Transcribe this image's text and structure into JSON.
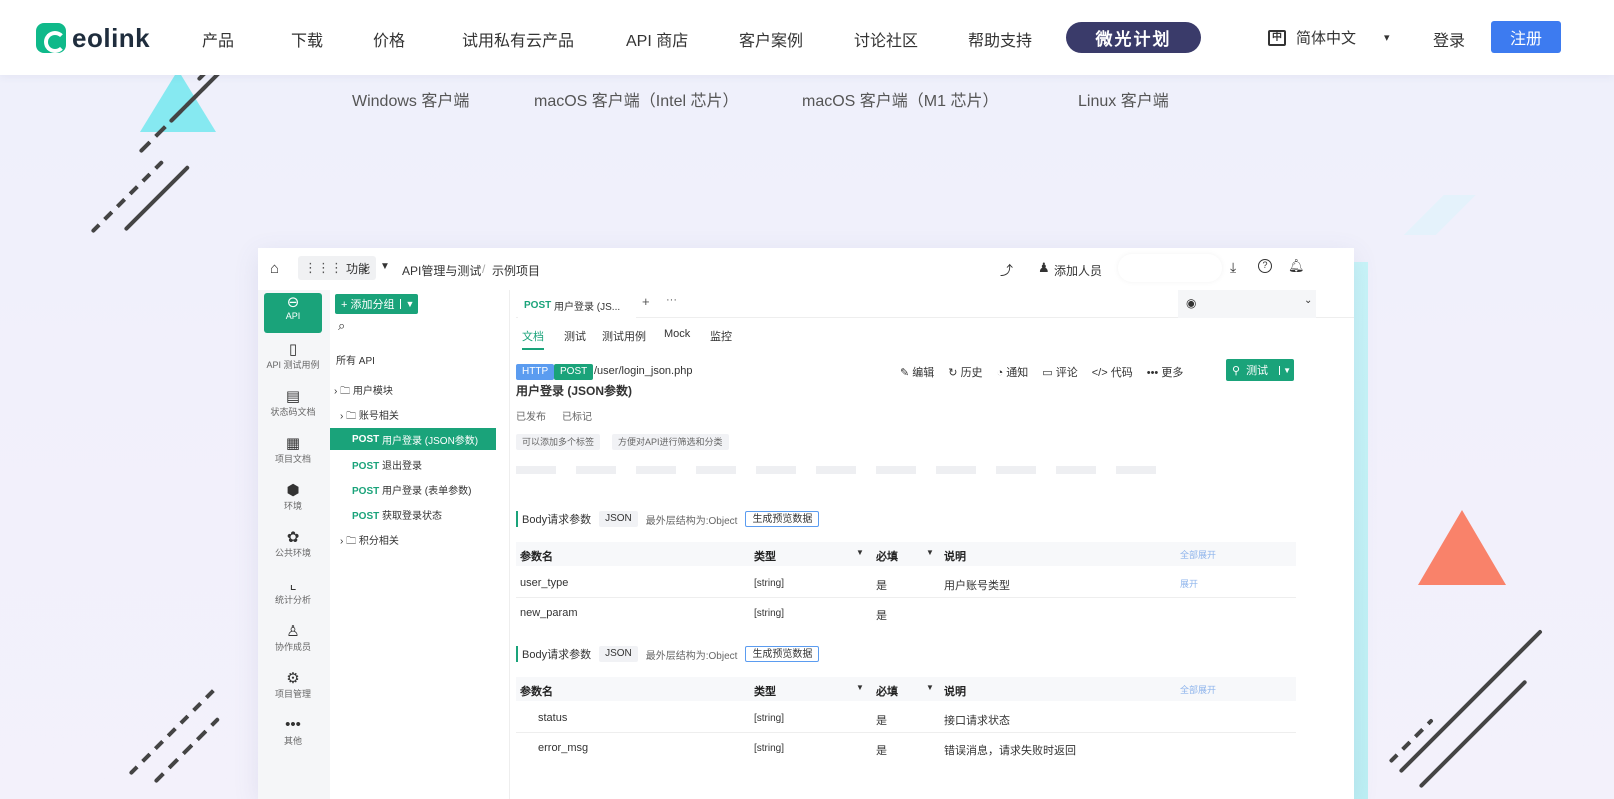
{
  "nav": {
    "brand": "eolink",
    "items": [
      "产品",
      "下载",
      "价格",
      "试用私有云产品",
      "API 商店",
      "客户案例",
      "讨论社区",
      "帮助支持"
    ],
    "badge": "微光计划",
    "lang_icon": "中",
    "lang": "简体中文",
    "login": "登录",
    "signup": "注册"
  },
  "downloads": [
    "Windows 客户端",
    "macOS 客户端（Intel 芯片）",
    "macOS 客户端（M1 芯片）",
    "Linux 客户端"
  ],
  "app": {
    "topbar": {
      "features": "功能",
      "breadcrumb_root": "API管理与测试",
      "breadcrumb_sep": "/",
      "breadcrumb_project": "示例项目",
      "add_member": "添加人员"
    },
    "leftbar": [
      {
        "icon": "link-icon",
        "label": "API"
      },
      {
        "icon": "clipboard-icon",
        "label": "API 测试用例"
      },
      {
        "icon": "doc-status-icon",
        "label": "状态码文档"
      },
      {
        "icon": "project-doc-icon",
        "label": "项目文档"
      },
      {
        "icon": "environment-icon",
        "label": "环境"
      },
      {
        "icon": "public-env-icon",
        "label": "公共环境"
      },
      {
        "icon": "chart-icon",
        "label": "统计分析"
      },
      {
        "icon": "member-icon",
        "label": "协作成员"
      },
      {
        "icon": "settings-icon",
        "label": "项目管理"
      },
      {
        "icon": "more-icon",
        "label": "其他"
      }
    ],
    "tree": {
      "add_group": "+ 添加分组",
      "all_api": "所有 API",
      "user_module": "用户模块",
      "account": "账号相关",
      "apis": [
        {
          "method": "POST",
          "name": "用户登录 (JSON参数)"
        },
        {
          "method": "POST",
          "name": "退出登录"
        },
        {
          "method": "POST",
          "name": "用户登录 (表单参数)"
        },
        {
          "method": "POST",
          "name": "获取登录状态"
        }
      ],
      "points": "积分相关"
    },
    "tab": {
      "method": "POST",
      "title": "用户登录 (JS..."
    },
    "subtabs": [
      "文档",
      "测试",
      "测试用例",
      "Mock",
      "监控"
    ],
    "api": {
      "protocol": "HTTP",
      "method": "POST",
      "path": "/user/login_json.php",
      "title": "用户登录 (JSON参数)",
      "status1": "已发布",
      "status2": "已标记",
      "tag1": "可以添加多个标签",
      "tag2": "方便对API进行筛选和分类"
    },
    "actions": [
      "编辑",
      "历史",
      "通知",
      "评论",
      "代码",
      "更多"
    ],
    "test_btn": "测试",
    "section1": {
      "title": "Body请求参数",
      "type": "JSON",
      "struct": "最外层结构为:Object",
      "gen": "生成预览数据"
    },
    "section2": {
      "title": "Body请求参数",
      "type": "JSON",
      "struct": "最外层结构为:Object",
      "gen": "生成预览数据"
    },
    "headers": {
      "name": "参数名",
      "type": "类型",
      "required": "必填",
      "desc": "说明",
      "expand": "全部展开"
    },
    "rows1": [
      {
        "name": "user_type",
        "type": "[string]",
        "required": "是",
        "desc": "用户账号类型",
        "extra": "展开"
      },
      {
        "name": "new_param",
        "type": "[string]",
        "required": "是",
        "desc": "",
        "extra": ""
      }
    ],
    "rows2": [
      {
        "name": "status",
        "type": "[string]",
        "required": "是",
        "desc": "接口请求状态"
      },
      {
        "name": "error_msg",
        "type": "[string]",
        "required": "是",
        "desc": "错误消息，请求失败时返回"
      }
    ]
  },
  "colors": {
    "brand": "#0fb98a",
    "accent": "#1aa37a",
    "signup": "#3d7bf0",
    "badge": "#3a3b6a"
  }
}
